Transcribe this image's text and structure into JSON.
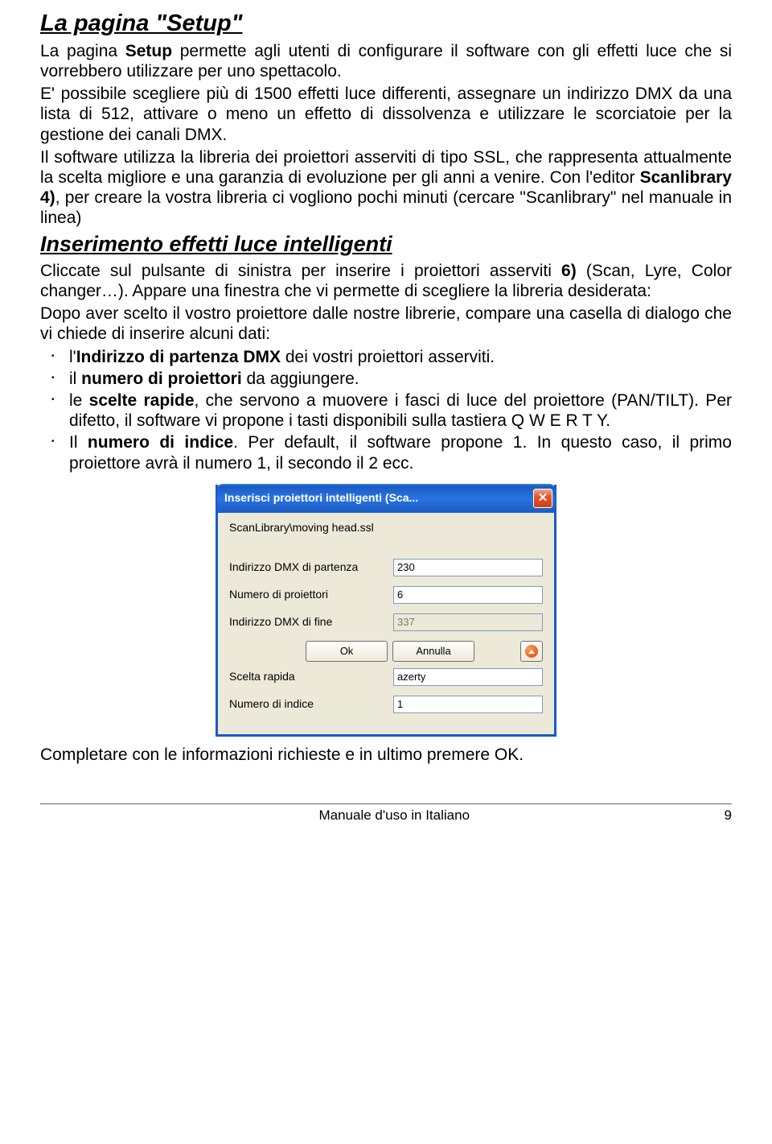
{
  "heading1": "La pagina \"Setup\"",
  "p1a": "La pagina ",
  "p1b": "Setup",
  "p1c": " permette agli utenti di configurare il software con gli effetti luce che si vorrebbero utilizzare per uno spettacolo.",
  "p2": "E' possibile scegliere più di 1500 effetti luce differenti, assegnare un indirizzo DMX da una lista di 512, attivare o meno un effetto di dissolvenza e utilizzare le scorciatoie per la gestione dei canali DMX.",
  "p3a": "Il software utilizza la libreria dei proiettori asserviti di tipo SSL, che rappresenta attualmente la scelta migliore e una garanzia di evoluzione per gli anni a venire. Con l'editor ",
  "p3b": "Scanlibrary 4)",
  "p3c": ", per creare la vostra libreria ci vogliono pochi minuti (cercare \"Scanlibrary\" nel manuale in linea)",
  "heading2": "Inserimento effetti luce intelligenti",
  "p4a": "Cliccate sul pulsante di sinistra per inserire i proiettori asserviti ",
  "p4b": "6)",
  "p4c": " (Scan, Lyre, Color changer…). Appare una finestra che vi permette di scegliere la libreria desiderata:",
  "p5": "Dopo aver scelto il vostro proiettore dalle nostre librerie, compare una casella di dialogo che vi chiede di inserire alcuni dati:",
  "li1a": "l'",
  "li1b": "Indirizzo di partenza DMX",
  "li1c": " dei vostri proiettori asserviti.",
  "li2a": "il ",
  "li2b": "numero di proiettori",
  "li2c": " da aggiungere.",
  "li3a": "le ",
  "li3b": "scelte rapide",
  "li3c": ", che servono a muovere i fasci di luce del proiettore (PAN/TILT). Per difetto, il software vi propone i tasti disponibili sulla tastiera Q W E R T Y.",
  "li4a": "Il ",
  "li4b": "numero di indice",
  "li4c": ". Per default, il software propone 1. In questo caso, il primo proiettore avrà il numero 1, il secondo il 2 ecc.",
  "dialog": {
    "title": "Inserisci proiettori intelligenti (Sca...",
    "path": "ScanLibrary\\moving head.ssl",
    "field1_label": "Indirizzo DMX di partenza",
    "field1_value": "230",
    "field2_label": "Numero di proiettori",
    "field2_value": "6",
    "field3_label": "Indirizzo DMX di fine",
    "field3_value": "337",
    "ok": "Ok",
    "cancel": "Annulla",
    "field4_label": "Scelta rapida",
    "field4_value": "azerty",
    "field5_label": "Numero di indice",
    "field5_value": "1"
  },
  "p6": "Completare con le informazioni richieste e in ultimo premere  OK.",
  "footer_text": "Manuale d'uso in Italiano",
  "page_num": "9"
}
